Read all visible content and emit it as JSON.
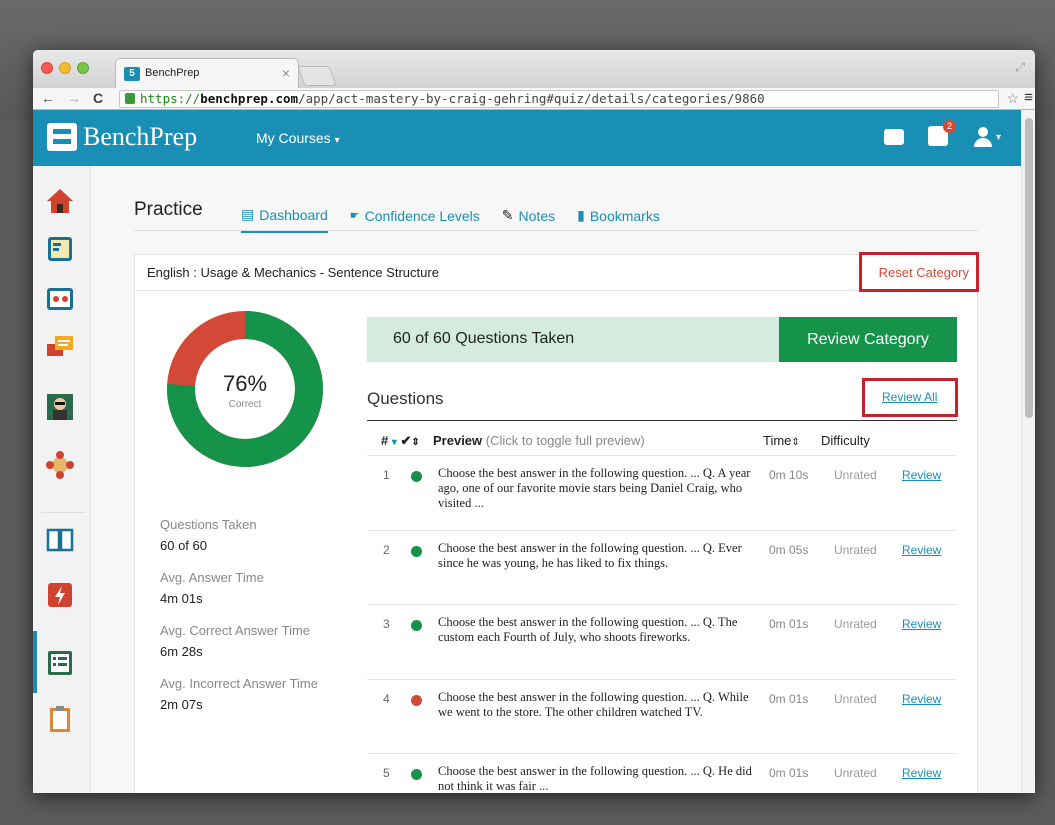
{
  "browser": {
    "tab_title": "BenchPrep",
    "tab_close": "×",
    "url_https": "https://",
    "url_host": "benchprep.com",
    "url_path": "/app/act-mastery-by-craig-gehring#quiz/details/categories/9860"
  },
  "app": {
    "logo": "BenchPrep",
    "nav_courses": "My Courses",
    "badge_count": "2",
    "accent": "#1a8fb5"
  },
  "sidebar": {
    "items": [
      "home-icon",
      "flashcards-icon",
      "games-icon",
      "discussion-icon",
      "tutor-icon",
      "study-group-icon",
      "book-icon",
      "practice-exam-icon",
      "quiz-icon",
      "clipboard-icon"
    ]
  },
  "page": {
    "title": "Practice",
    "tabs": [
      {
        "label": "Dashboard",
        "icon": "list-icon"
      },
      {
        "label": "Confidence Levels",
        "icon": "hand-icon"
      },
      {
        "label": "Notes",
        "icon": "pencil-icon"
      },
      {
        "label": "Bookmarks",
        "icon": "bookmark-icon"
      }
    ],
    "category": "English : Usage & Mechanics - Sentence Structure",
    "reset": "Reset Category"
  },
  "summary": {
    "percent": "76%",
    "percent_label": "Correct",
    "correct_fraction": 0.76,
    "taken_text": "60 of 60 Questions Taken",
    "review_category": "Review Category",
    "stats": [
      {
        "label": "Questions Taken",
        "value": "60 of 60"
      },
      {
        "label": "Avg. Answer Time",
        "value": "4m 01s"
      },
      {
        "label": "Avg. Correct Answer Time",
        "value": "6m 28s"
      },
      {
        "label": "Avg. Incorrect Answer Time",
        "value": "2m 07s"
      }
    ]
  },
  "questions": {
    "title": "Questions",
    "review_all": "Review All",
    "headers": {
      "num": "#",
      "preview": "Preview",
      "preview_hint": "(Click to toggle full preview)",
      "time": "Time",
      "difficulty": "Difficulty"
    },
    "rows": [
      {
        "num": "1",
        "status": "correct",
        "text": "Choose the best answer in the following question. ... Q. A year ago, one of our favorite movie stars being Daniel Craig, who visited ...",
        "time": "0m 10s",
        "difficulty": "Unrated",
        "action": "Review"
      },
      {
        "num": "2",
        "status": "correct",
        "text": "Choose the best answer in the following question. ... Q. Ever since he was young, he has liked to fix things.",
        "time": "0m 05s",
        "difficulty": "Unrated",
        "action": "Review"
      },
      {
        "num": "3",
        "status": "correct",
        "text": "Choose the best answer in the following question. ... Q. The custom each Fourth of July, who shoots fireworks.",
        "time": "0m 01s",
        "difficulty": "Unrated",
        "action": "Review"
      },
      {
        "num": "4",
        "status": "incorrect",
        "text": "Choose the best answer in the following question. ... Q. While we went to the store. The other children watched TV.",
        "time": "0m 01s",
        "difficulty": "Unrated",
        "action": "Review"
      },
      {
        "num": "5",
        "status": "correct",
        "text": "Choose the best answer in the following question. ... Q. He did not think it was fair ...",
        "time": "0m 01s",
        "difficulty": "Unrated",
        "action": "Review"
      }
    ]
  },
  "colors": {
    "correct": "#16934a",
    "incorrect": "#d24a37",
    "highlight_box": "#c8202c"
  }
}
